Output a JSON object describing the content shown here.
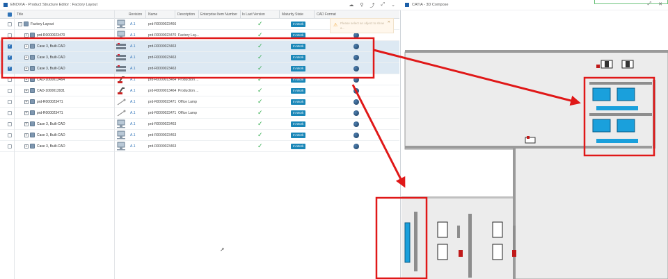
{
  "left_window": {
    "title": "ENOVIA - Product Structure Editor : Factory Layout",
    "icons": [
      "cloud-icon",
      "attachment-icon",
      "share-icon",
      "expand-icon",
      "chevron-down-icon"
    ]
  },
  "grid": {
    "columns": [
      "Title",
      "Revision",
      "Name",
      "Description",
      "Enterprise Item Number",
      "Is Last Version",
      "Maturity State",
      "CAD Format"
    ],
    "rows": [
      {
        "indent": 0,
        "expander": "−",
        "title": "Factory Layout",
        "revision": "A.1",
        "name": "prd-R0000023466",
        "description": "",
        "last": true,
        "state": "In Work",
        "globe": false,
        "selected": false,
        "thumb": "monitor"
      },
      {
        "indent": 1,
        "expander": "+",
        "title": "prd-R0000023470",
        "revision": "A.1",
        "name": "prd-R0000023470",
        "description": "Factory Lay...",
        "last": true,
        "state": "In Work",
        "globe": true,
        "selected": false,
        "thumb": "monitor"
      },
      {
        "indent": 1,
        "expander": "+",
        "title": "Case 3, Built-CAD",
        "revision": "A.1",
        "name": "prd-R0000023463",
        "description": "",
        "last": true,
        "state": "In Work",
        "globe": true,
        "selected": true,
        "thumb": "rack"
      },
      {
        "indent": 1,
        "expander": "+",
        "title": "Case 3, Built-CAD",
        "revision": "A.1",
        "name": "prd-R0000023463",
        "description": "",
        "last": true,
        "state": "In Work",
        "globe": true,
        "selected": true,
        "thumb": "rack"
      },
      {
        "indent": 1,
        "expander": "+",
        "title": "Case 3, Built-CAD",
        "revision": "A.1",
        "name": "prd-R0000023463",
        "description": "",
        "last": true,
        "state": "In Work",
        "globe": true,
        "selected": true,
        "thumb": "rack"
      },
      {
        "indent": 1,
        "expander": "+",
        "title": "CAD-1000013464",
        "revision": "A.1",
        "name": "prd-R0000013464",
        "description": "Production ...",
        "last": true,
        "state": "In Work",
        "globe": true,
        "selected": false,
        "thumb": "robot"
      },
      {
        "indent": 1,
        "expander": "+",
        "title": "CAD-1000013931",
        "revision": "A.1",
        "name": "prd-R0000013464",
        "description": "Production ...",
        "last": true,
        "state": "In Work",
        "globe": true,
        "selected": false,
        "thumb": "robot"
      },
      {
        "indent": 1,
        "expander": "+",
        "title": "prd-R000023471",
        "revision": "A.1",
        "name": "prd-R0000023471",
        "description": "Office Lamp",
        "last": true,
        "state": "In Work",
        "globe": true,
        "selected": false,
        "thumb": "lamp"
      },
      {
        "indent": 1,
        "expander": "+",
        "title": "prd-R000023471",
        "revision": "A.1",
        "name": "prd-R0000023471",
        "description": "Office Lamp",
        "last": true,
        "state": "In Work",
        "globe": true,
        "selected": false,
        "thumb": "lamp"
      },
      {
        "indent": 1,
        "expander": "+",
        "title": "Case 3, Built-CAD",
        "revision": "A.1",
        "name": "prd-R0000023463",
        "description": "",
        "last": true,
        "state": "In Work",
        "globe": true,
        "selected": false,
        "thumb": "monitor"
      },
      {
        "indent": 1,
        "expander": "+",
        "title": "Case 3, Built-CAD",
        "revision": "A.1",
        "name": "prd-R0000023463",
        "description": "",
        "last": true,
        "state": "In Work",
        "globe": true,
        "selected": false,
        "thumb": "monitor"
      },
      {
        "indent": 1,
        "expander": "+",
        "title": "Case 3, Built-CAD",
        "revision": "A.1",
        "name": "prd-R0000023463",
        "description": "",
        "last": true,
        "state": "In Work",
        "globe": true,
        "selected": false,
        "thumb": "monitor"
      }
    ]
  },
  "notification": {
    "text": "Please select an object to show a..."
  },
  "right_window": {
    "title": "CATIA - 3D Compose",
    "icons": [
      "expand-icon",
      "close-icon"
    ]
  },
  "colors": {
    "selection": "#dde9f3",
    "state_badge": "#1a87b8",
    "check": "#2eaa4a",
    "annotation": "#e01818",
    "floor": "#ececec",
    "wall": "#9a9a9a",
    "highlight_blue": "#1aa0dc"
  }
}
